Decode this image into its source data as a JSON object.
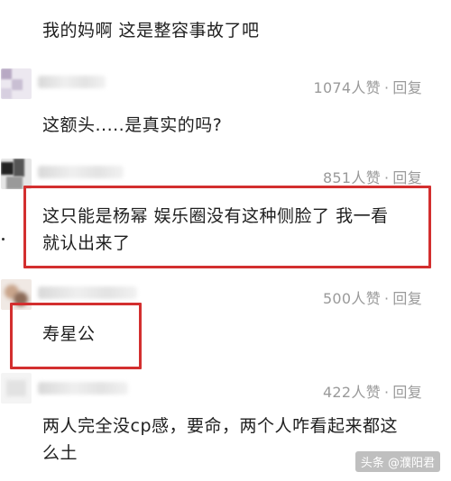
{
  "comments": [
    {
      "text": "我的妈啊 这是整容事故了吧"
    },
    {
      "likes": "1074人赞",
      "reply_label": "回复",
      "text": "这额头.....是真实的吗?"
    },
    {
      "likes": "851人赞",
      "reply_label": "回复",
      "text_line1": "这只能是杨幂 娱乐圈没有这种侧脸了 我一看",
      "text_line2": "就认出来了"
    },
    {
      "likes": "500人赞",
      "reply_label": "回复",
      "text": "寿星公"
    },
    {
      "likes": "422人赞",
      "reply_label": "回复",
      "text_line1": "两人完全没cp感，要命，两个人咋看起来都这",
      "text_line2": "么土"
    }
  ],
  "separator": "·",
  "watermark": "头条 @濮阳君",
  "colors": {
    "highlight_box": "#d32f2f",
    "meta_text": "#9a9a9a"
  }
}
